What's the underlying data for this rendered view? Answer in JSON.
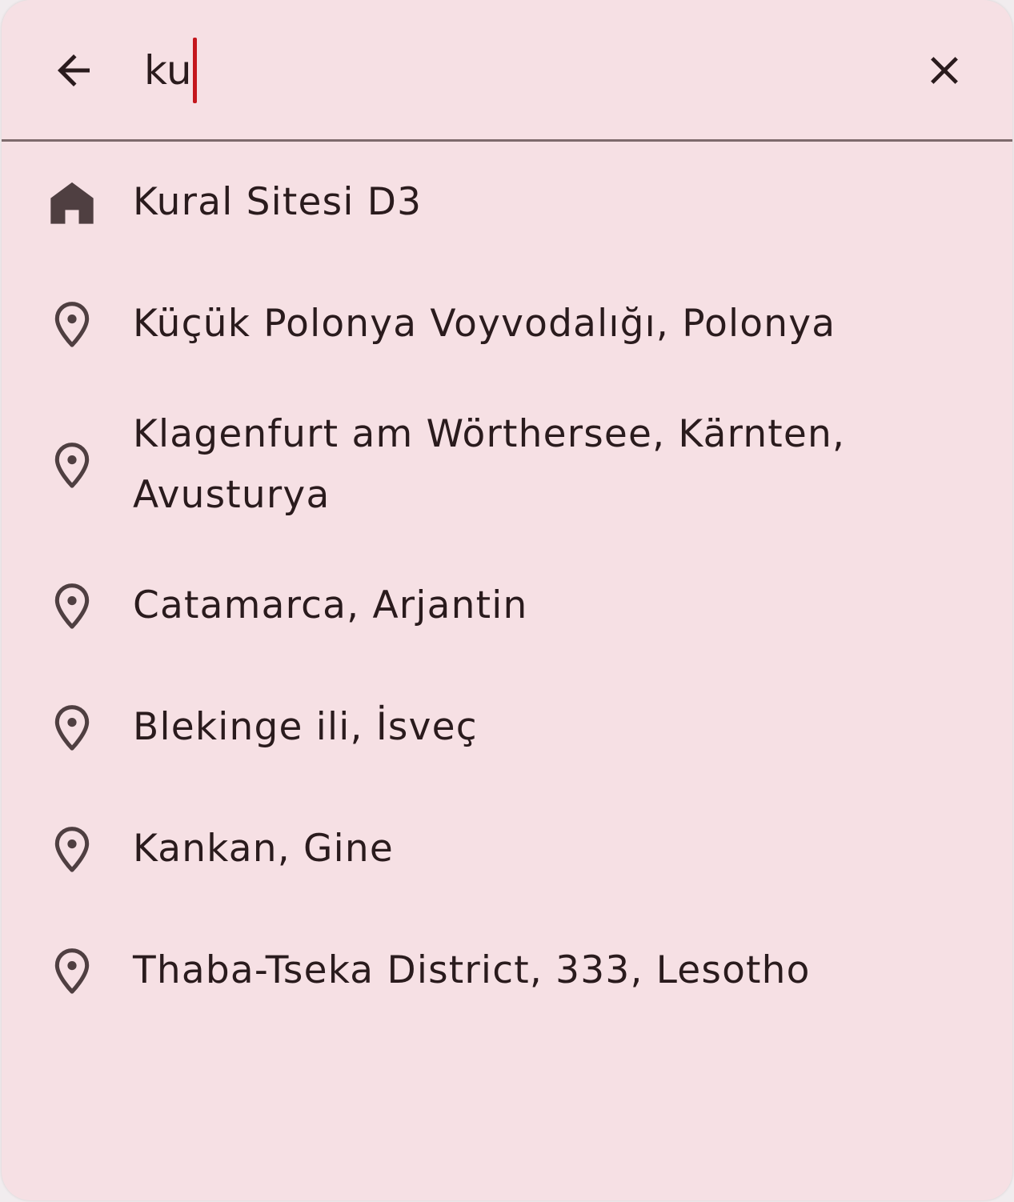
{
  "search": {
    "query": "ku",
    "back_icon": "arrow-back-icon",
    "clear_icon": "close-icon"
  },
  "results": [
    {
      "icon": "home-icon",
      "label": "Kural Sitesi D3"
    },
    {
      "icon": "location-pin-icon",
      "label": "Küçük Polonya Voyvodalığı, Polonya"
    },
    {
      "icon": "location-pin-icon",
      "label": "Klagenfurt am Wörthersee, Kärnten, Avusturya"
    },
    {
      "icon": "location-pin-icon",
      "label": "Catamarca, Arjantin"
    },
    {
      "icon": "location-pin-icon",
      "label": "Blekinge ili, İsveç"
    },
    {
      "icon": "location-pin-icon",
      "label": "Kankan, Gine"
    },
    {
      "icon": "location-pin-icon",
      "label": "Thaba-Tseka District, 333, Lesotho"
    }
  ],
  "colors": {
    "background": "#f6e0e4",
    "text": "#2a1b1d",
    "icon": "#4f3f41",
    "caret": "#c4171d",
    "divider": "#7d6a6c"
  }
}
